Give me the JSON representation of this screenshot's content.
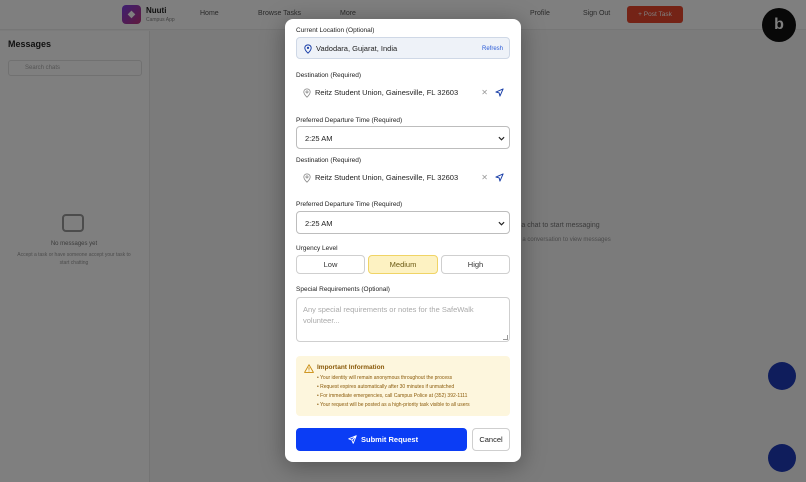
{
  "background": {
    "brand": {
      "name": "Nuuti",
      "subtitle": "Campus App"
    },
    "nav": [
      "Home",
      "Browse Tasks",
      "More"
    ],
    "profile": "Profile",
    "sign_out": "Sign Out",
    "post_task": "+ Post Task",
    "messages": {
      "title": "Messages",
      "search_placeholder": "Search chats",
      "empty_title": "No messages yet",
      "empty_desc": "Accept a task or have someone accept your task to start chatting"
    },
    "main_empty_title": "Select a chat to start messaging",
    "main_empty_desc": "Choose a conversation to view messages"
  },
  "modal": {
    "current_location": {
      "label": "Current Location (Optional)",
      "value": "Vadodara, Gujarat, India",
      "refresh": "Refresh"
    },
    "destinations": [
      {
        "label": "Destination (Required)",
        "value": "Reitz Student Union, Gainesville, FL 32603"
      },
      {
        "label": "Destination (Required)",
        "value": "Reitz Student Union, Gainesville, FL 32603"
      }
    ],
    "departure_times": [
      {
        "label": "Preferred Departure Time (Required)",
        "value": "2:25 AM"
      },
      {
        "label": "Preferred Departure Time (Required)",
        "value": "2:25 AM"
      }
    ],
    "urgency": {
      "label": "Urgency Level",
      "options": [
        "Low",
        "Medium",
        "High"
      ],
      "selected": "Medium"
    },
    "special": {
      "label": "Special Requirements (Optional)",
      "placeholder": "Any special requirements or notes for the SafeWalk volunteer..."
    },
    "info": {
      "title": "Important Information",
      "items": [
        "• Your identity will remain anonymous throughout the process",
        "• Request expires automatically after 30 minutes if unmatched",
        "• For immediate emergencies, call Campus Police at (352) 392-1111",
        "• Your request will be posted as a high-priority task visible to all users"
      ]
    },
    "submit_label": "Submit Request",
    "cancel_label": "Cancel"
  },
  "colors": {
    "primary": "#0b3df5",
    "warning_bg": "#fdf6dd",
    "warning_text": "#8a5a0a",
    "selected_bg": "#fdf2c2"
  }
}
